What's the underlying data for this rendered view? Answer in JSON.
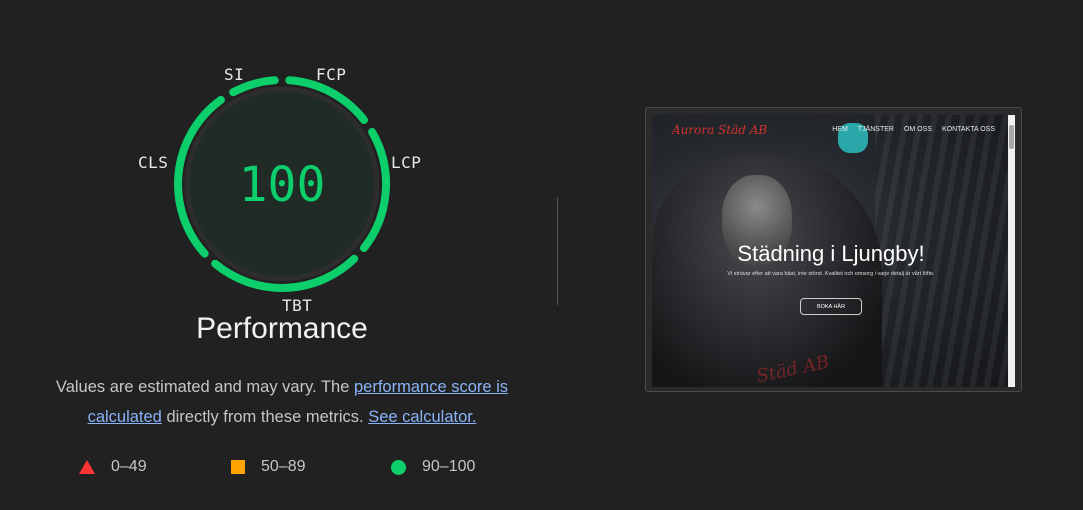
{
  "gauge": {
    "score": "100",
    "title": "Performance",
    "metrics": {
      "si": "SI",
      "fcp": "FCP",
      "lcp": "LCP",
      "tbt": "TBT",
      "cls": "CLS"
    },
    "color": "#0cce6b"
  },
  "description": {
    "text_1": "Values are estimated and may vary. The ",
    "link_score": "performance score is calculated",
    "text_2": " directly from these metrics. ",
    "link_calculator": "See calculator."
  },
  "legend": [
    {
      "shape": "triangle",
      "label": "0–49",
      "color": "#ff3333"
    },
    {
      "shape": "square",
      "label": "50–89",
      "color": "#ffa400"
    },
    {
      "shape": "circle",
      "label": "90–100",
      "color": "#0cce6b"
    }
  ],
  "screenshot": {
    "brand": "Aurora Städ AB",
    "nav": [
      "HEM",
      "TJÄNSTER",
      "OM OSS",
      "KONTAKTA OSS"
    ],
    "headline": "Städning i Ljungby!",
    "subtext": "Vi strävar efter att vara bäst, inte störst. Kvalitet och omsorg i varje detalj är vårt löfte.",
    "cta": "BOKA HÄR",
    "watermark": "Städ AB"
  }
}
